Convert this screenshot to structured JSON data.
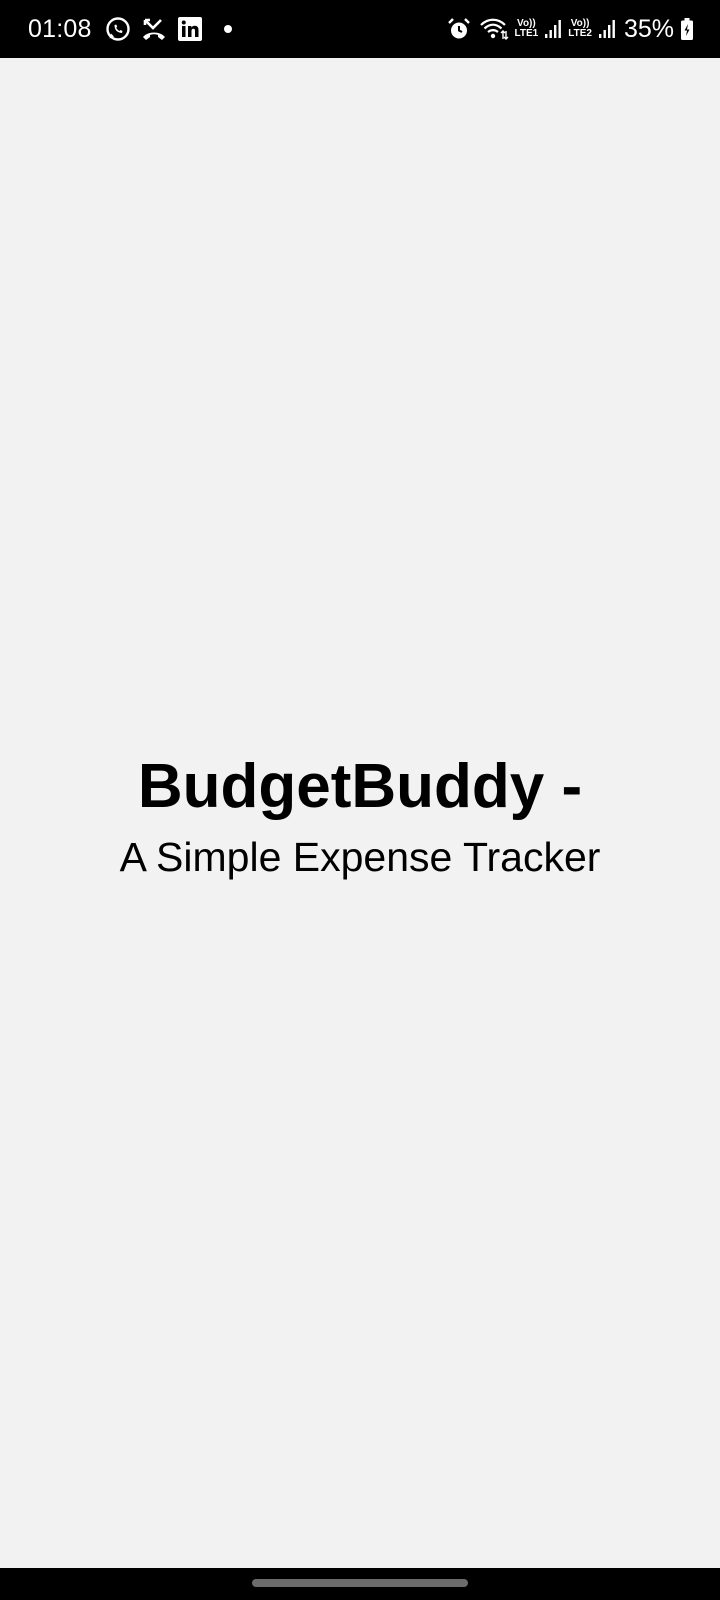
{
  "status_bar": {
    "time": "01:08",
    "left_icons": [
      "whatsapp-icon",
      "missed-call-icon",
      "linkedin-icon"
    ],
    "right_icons": [
      "alarm-icon",
      "wifi-icon",
      "signal-icon",
      "battery-icon"
    ],
    "sim1": {
      "top": "Vo))",
      "bottom": "LTE1"
    },
    "sim2": {
      "top": "Vo))",
      "bottom": "LTE2"
    },
    "battery_percent": "35%"
  },
  "main": {
    "title": "BudgetBuddy -",
    "subtitle": "A Simple Expense Tracker"
  },
  "colors": {
    "background": "#f2f2f2",
    "status_bar": "#000000",
    "text": "#000000"
  }
}
